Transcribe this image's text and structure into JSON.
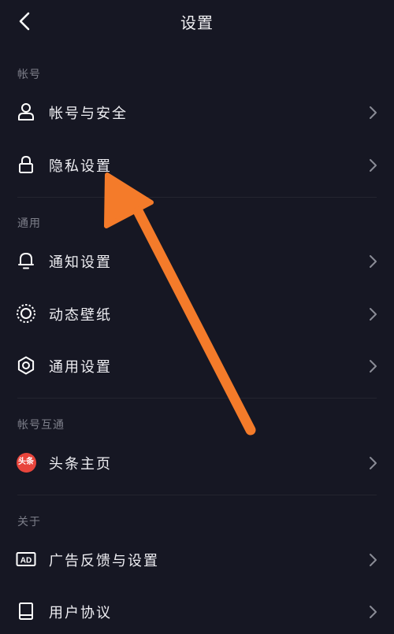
{
  "header": {
    "title": "设置"
  },
  "sections": {
    "account": {
      "label": "帐号"
    },
    "general": {
      "label": "通用"
    },
    "interconnect": {
      "label": "帐号互通"
    },
    "about": {
      "label": "关于"
    }
  },
  "items": {
    "account_security": {
      "label": "帐号与安全",
      "icon": "user-icon"
    },
    "privacy": {
      "label": "隐私设置",
      "icon": "lock-icon"
    },
    "notifications": {
      "label": "通知设置",
      "icon": "bell-icon"
    },
    "live_wallpaper": {
      "label": "动态壁纸",
      "icon": "dotted-circle-icon"
    },
    "general_settings": {
      "label": "通用设置",
      "icon": "gear-icon"
    },
    "toutiao": {
      "label": "头条主页",
      "icon": "toutiao-icon",
      "badge_text": "头条"
    },
    "ad_feedback": {
      "label": "广告反馈与设置",
      "icon": "ad-icon",
      "badge_text": "AD"
    },
    "user_agreement": {
      "label": "用户协议",
      "icon": "book-icon"
    }
  },
  "colors": {
    "background": "#161723",
    "section_text": "#7d7f8a",
    "annotation_arrow": "#f47b2a",
    "toutiao_badge": "#e8453c"
  }
}
